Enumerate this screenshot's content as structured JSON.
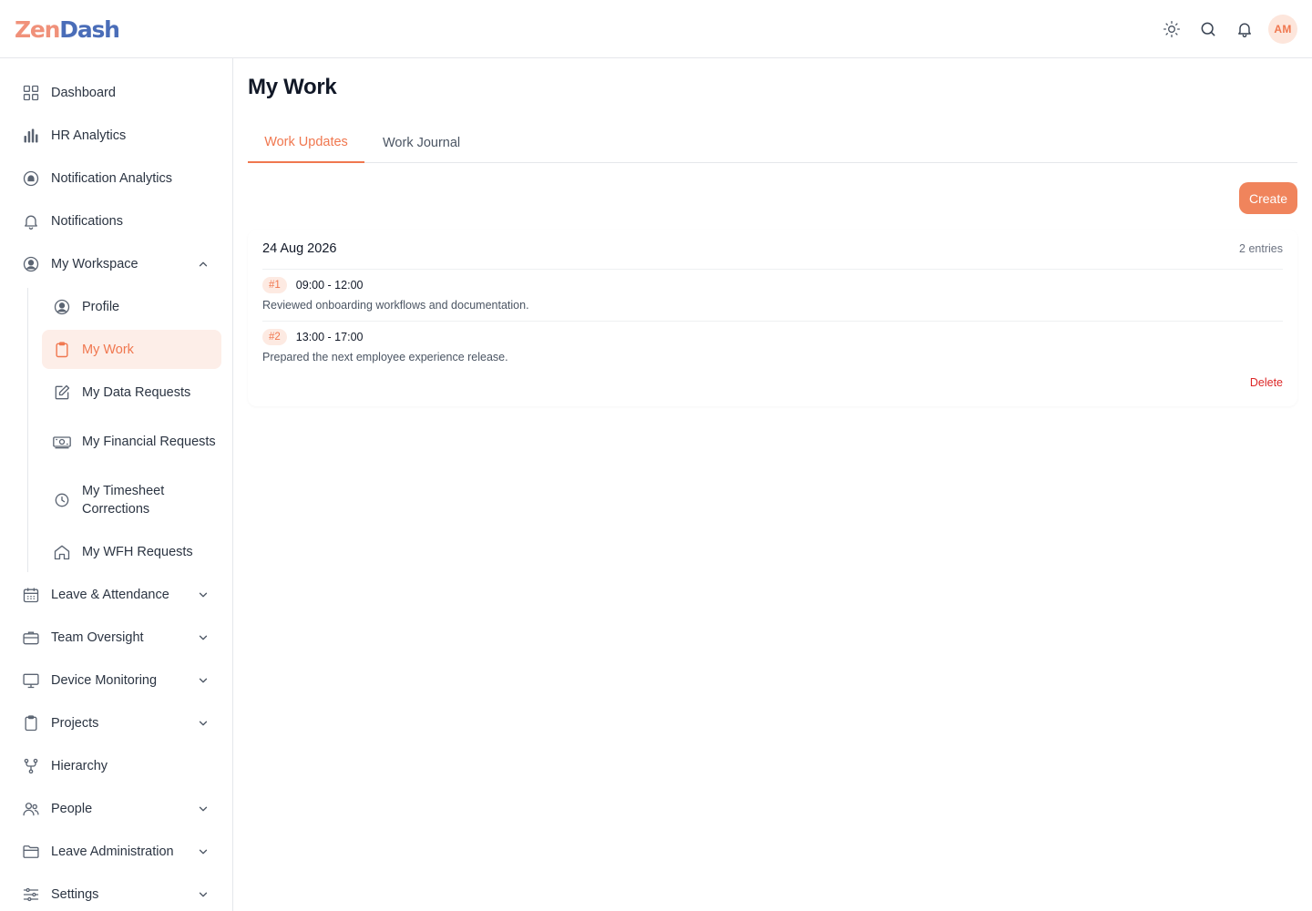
{
  "app": {
    "logo_part1": "Zen",
    "logo_part2": "Dash",
    "user_initials": "AM"
  },
  "header": {
    "icons": [
      "sun-icon",
      "search-icon",
      "bell-icon"
    ]
  },
  "sidebar": {
    "items": [
      {
        "label": "Dashboard",
        "icon": "grid-icon"
      },
      {
        "label": "HR Analytics",
        "icon": "bar-chart-icon"
      },
      {
        "label": "Notification Analytics",
        "icon": "notification-analytics-icon"
      },
      {
        "label": "Notifications",
        "icon": "bell-icon"
      },
      {
        "label": "My Workspace",
        "icon": "user-circle-icon",
        "expanded": true
      },
      {
        "label": "Leave & Attendance",
        "icon": "calendar-icon"
      },
      {
        "label": "Team Oversight",
        "icon": "briefcase-icon"
      },
      {
        "label": "Device Monitoring",
        "icon": "monitor-icon"
      },
      {
        "label": "Projects",
        "icon": "clipboard-icon"
      },
      {
        "label": "Hierarchy",
        "icon": "hierarchy-icon"
      },
      {
        "label": "People",
        "icon": "people-icon"
      },
      {
        "label": "Leave Administration",
        "icon": "folder-icon"
      },
      {
        "label": "Settings",
        "icon": "sliders-icon"
      }
    ],
    "workspace_items": [
      {
        "label": "Profile",
        "icon": "user-circle-icon"
      },
      {
        "label": "My Work",
        "icon": "clipboard-icon",
        "active": true
      },
      {
        "label": "My Data Requests",
        "icon": "edit-icon"
      },
      {
        "label": "My Financial Requests",
        "icon": "banknote-icon"
      },
      {
        "label": "My Timesheet Corrections",
        "icon": "clock-icon"
      },
      {
        "label": "My WFH Requests",
        "icon": "home-icon"
      }
    ]
  },
  "main": {
    "title": "My Work",
    "tabs": [
      {
        "label": "Work Updates",
        "active": true
      },
      {
        "label": "Work Journal",
        "active": false
      }
    ],
    "create_label": "Create",
    "group": {
      "date": "24 Aug 2026",
      "count": "2 entries",
      "entries": [
        {
          "badge": "#1",
          "time": "09:00 - 12:00",
          "description": "Reviewed onboarding workflows and documentation."
        },
        {
          "badge": "#2",
          "time": "13:00 - 17:00",
          "description": "Prepared the next employee experience release."
        }
      ],
      "delete_label": "Delete"
    }
  },
  "colors": {
    "accent": "#f0774f",
    "accent_bg": "#fdeee8",
    "danger": "#dc2626"
  }
}
